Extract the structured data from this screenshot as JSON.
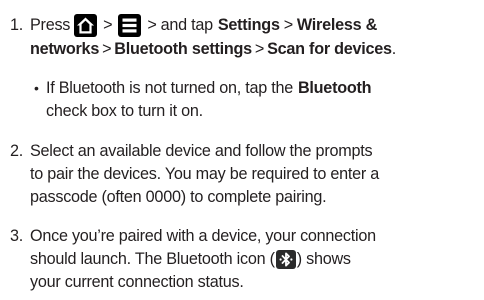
{
  "steps": [
    {
      "number": "1.",
      "line1": {
        "press": "Press",
        "sep1": ">",
        "sep2": ">",
        "and_tap": "and tap",
        "settings": "Settings",
        "sep3": ">",
        "wireless": "Wireless &"
      },
      "line2": {
        "networks": "networks",
        "sep1": ">",
        "bt_settings": "Bluetooth settings",
        "sep2": ">",
        "scan": "Scan for devices",
        "period": "."
      },
      "sub_bullet": {
        "glyph": "•",
        "line1_pre": "If Bluetooth is not turned on, tap the",
        "line1_bold": "Bluetooth",
        "line2": "check box to turn it on."
      }
    },
    {
      "number": "2.",
      "lines": [
        "Select an available device and follow the prompts",
        "to pair the devices. You may be required to enter a",
        "passcode (often 0000) to complete pairing."
      ]
    },
    {
      "number": "3.",
      "line1": "Once you’re paired with a device, your connection",
      "line2_pre": "should launch. The Bluetooth icon (",
      "line2_post": ") shows",
      "line3": "your current connection status."
    }
  ],
  "icons": {
    "home": "home-icon",
    "menu": "menu-icon",
    "bluetooth": "bluetooth-icon"
  },
  "colors": {
    "text": "#231f20",
    "key_bg": "#000000",
    "bt_badge_bg": "#2b2b2b"
  }
}
